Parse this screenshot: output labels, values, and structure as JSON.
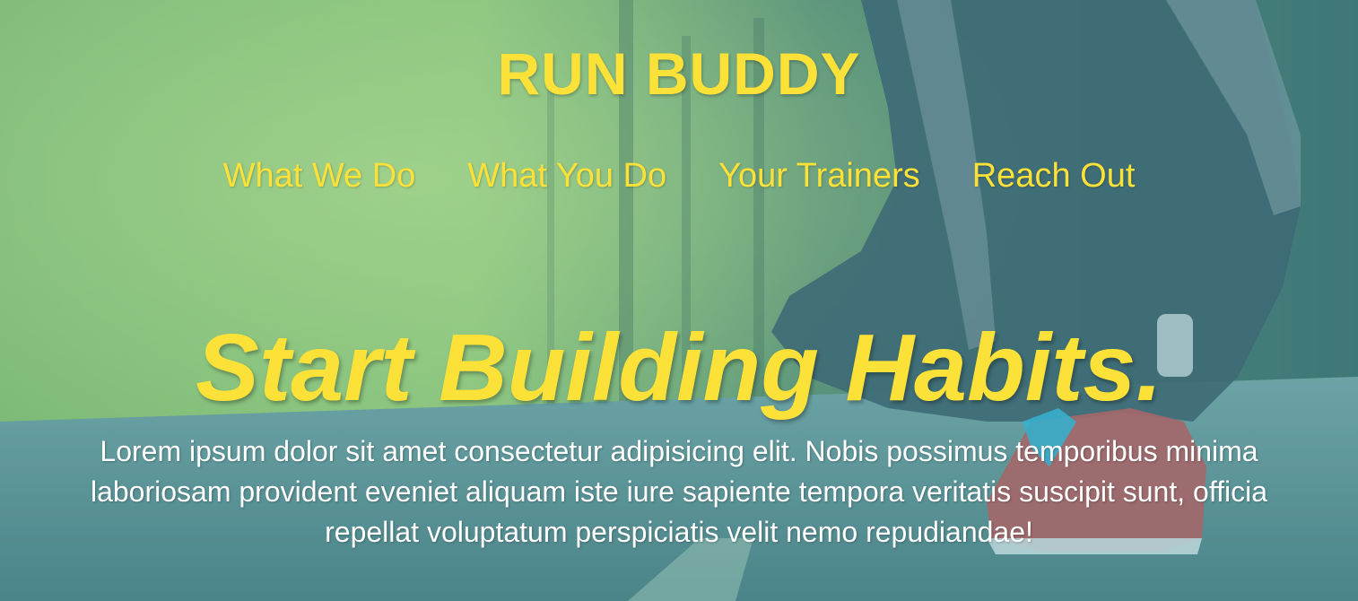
{
  "header": {
    "logo": "RUN BUDDY",
    "nav": [
      {
        "label": "What We Do"
      },
      {
        "label": "What You Do"
      },
      {
        "label": "Your Trainers"
      },
      {
        "label": "Reach Out"
      }
    ]
  },
  "hero": {
    "headline": "Start Building Habits.",
    "intro": "Lorem ipsum dolor sit amet consectetur adipisicing elit. Nobis possimus temporibus minima laboriosam provident eveniet aliquam iste iure sapiente tempora veritatis suscipit sunt, officia repellat voluptatum perspiciatis velit nemo repudiandae!"
  },
  "colors": {
    "accent": "#fce138",
    "text": "#ffffff"
  }
}
